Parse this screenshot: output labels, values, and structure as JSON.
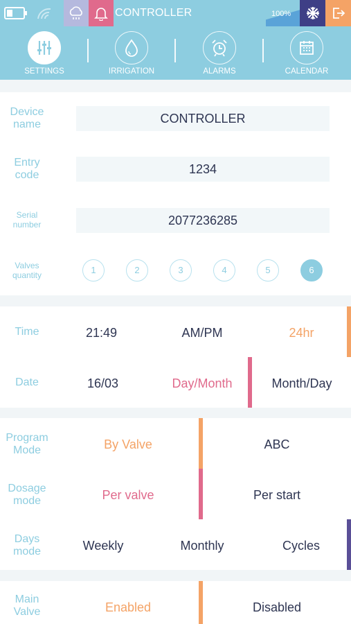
{
  "status_bar": {
    "title": "CONTROLLER",
    "battery_percent": "100%",
    "icons": [
      "battery-icon",
      "wifi-icon",
      "rain-cloud-icon",
      "bell-icon",
      "snowflake-icon",
      "exit-icon"
    ]
  },
  "tabs": [
    {
      "label": "SETTINGS",
      "icon": "sliders-icon",
      "active": true
    },
    {
      "label": "IRRIGATION",
      "icon": "water-drop-icon",
      "active": false
    },
    {
      "label": "ALARMS",
      "icon": "alarm-clock-icon",
      "active": false
    },
    {
      "label": "CALENDAR",
      "icon": "calendar-icon",
      "active": false
    }
  ],
  "device": {
    "name_label_1": "Device",
    "name_label_2": "name",
    "name_value": "CONTROLLER",
    "entry_label_1": "Entry",
    "entry_label_2": "code",
    "entry_value": "1234",
    "serial_label_1": "Serial",
    "serial_label_2": "number",
    "serial_value": "2077236285",
    "valves_label_1": "Valves",
    "valves_label_2": "quantity",
    "valves": [
      "1",
      "2",
      "3",
      "4",
      "5",
      "6"
    ],
    "valves_selected": "6"
  },
  "time": {
    "time_label": "Time",
    "time_value": "21:49",
    "ampm": "AM/PM",
    "h24": "24hr",
    "date_label": "Date",
    "date_value": "16/03",
    "day_month": "Day/Month",
    "month_day": "Month/Day"
  },
  "modes": {
    "program_label_1": "Program",
    "program_label_2": "Mode",
    "by_valve": "By Valve",
    "abc": "ABC",
    "dosage_label_1": "Dosage",
    "dosage_label_2": "mode",
    "per_valve": "Per valve",
    "per_start": "Per start",
    "days_label_1": "Days",
    "days_label_2": "mode",
    "weekly": "Weekly",
    "monthly": "Monthly",
    "cycles": "Cycles"
  },
  "main_valve": {
    "label_1": "Main",
    "label_2": "Valve",
    "enabled": "Enabled",
    "disabled": "Disabled"
  },
  "colors": {
    "header": "#8dcde0",
    "orange": "#f4a366",
    "pink": "#e06a8c",
    "navy": "#2e3552",
    "indigo": "#5a4f97",
    "lavender": "#b5b9de"
  }
}
